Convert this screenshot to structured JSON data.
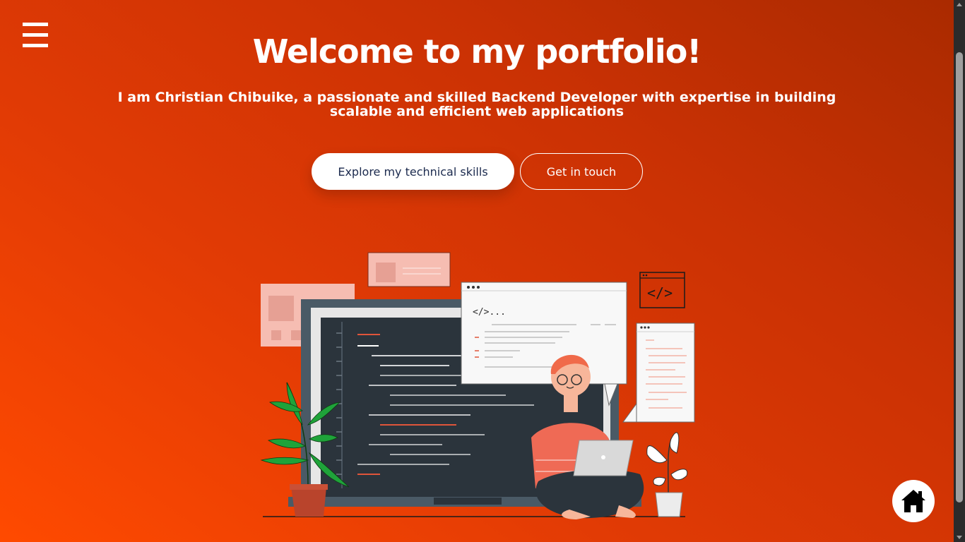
{
  "header": {
    "menu_icon": "hamburger-menu-icon",
    "title": "Welcome to my portfolio!",
    "subtitle": "I am Christian Chibuike, a passionate and skilled Backend Developer with expertise in building scalable and efficient web applications"
  },
  "actions": {
    "primary_label": "Explore my technical skills",
    "secondary_label": "Get in touch"
  },
  "illustration": {
    "code_snippet": "</>...",
    "code_tag": "</>"
  },
  "fab": {
    "icon": "home-icon"
  },
  "colors": {
    "accent": "#ff4a00",
    "accent_dark": "#a92a00",
    "button_text": "#1b2a4e",
    "white": "#ffffff"
  }
}
